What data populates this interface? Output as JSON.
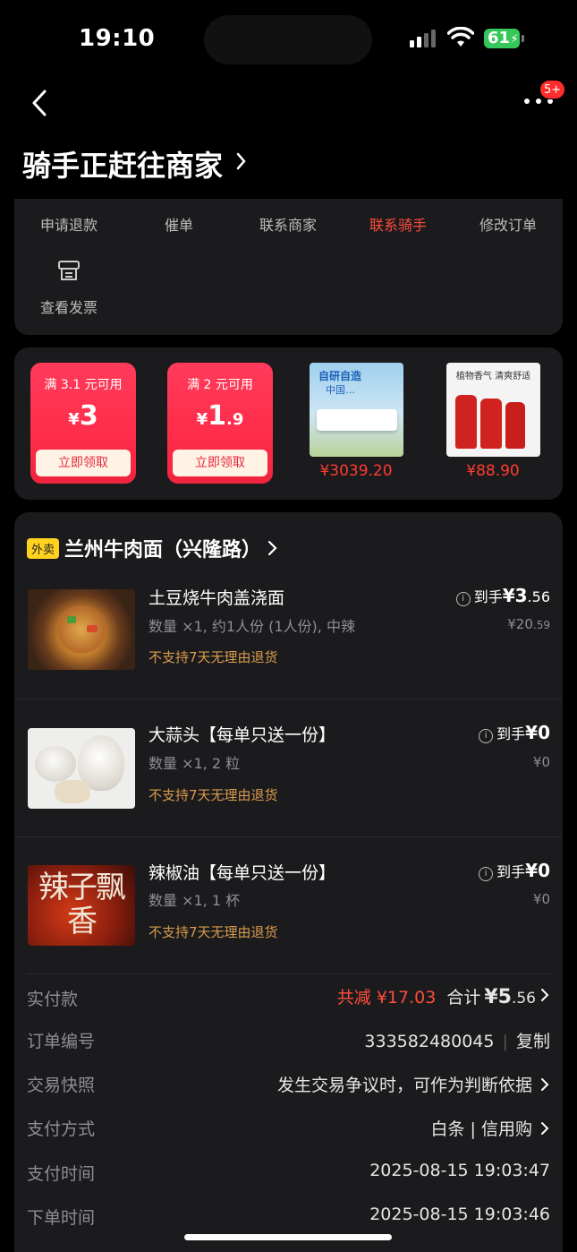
{
  "status_bar": {
    "time": "19:10",
    "battery": "61"
  },
  "nav": {
    "badge": "5+"
  },
  "header": {
    "title": "骑手正赶往商家"
  },
  "actions": {
    "refund": "申请退款",
    "urge": "催单",
    "contact_store": "联系商家",
    "contact_rider": "联系骑手",
    "modify": "修改订单",
    "invoice": "查看发票"
  },
  "promos": {
    "coupons": [
      {
        "condition": "满 3.1 元可用",
        "currency": "¥",
        "amount_int": "3",
        "amount_dec": "",
        "button": "立即领取"
      },
      {
        "condition": "满 2 元可用",
        "currency": "¥",
        "amount_int": "1",
        "amount_dec": ".9",
        "button": "立即领取"
      }
    ],
    "products": [
      {
        "price": "¥3039.20",
        "image_text_1": "自研自造",
        "image_text_2": "中国…"
      },
      {
        "price": "¥88.90",
        "image_text_1": "植物香气 清爽舒适"
      }
    ]
  },
  "order": {
    "tag": "外卖",
    "store": "兰州牛肉面（兴隆路）",
    "items": [
      {
        "name": "土豆烧牛肉盖浇面",
        "spec": "数量 ×1, 约1人份 (1人份), 中辣",
        "note": "不支持7天无理由退货",
        "final_label": "到手",
        "final_int": "¥3",
        "final_dec": ".56",
        "orig_int": "¥20",
        "orig_dec": ".59"
      },
      {
        "name": "大蒜头【每单只送一份】",
        "spec": "数量 ×1, 2 粒",
        "note": "不支持7天无理由退货",
        "final_label": "到手",
        "final_int": "¥0",
        "final_dec": "",
        "orig_int": "¥0",
        "orig_dec": ""
      },
      {
        "name": "辣椒油【每单只送一份】",
        "spec": "数量 ×1, 1 杯",
        "note": "不支持7天无理由退货",
        "final_label": "到手",
        "final_int": "¥0",
        "final_dec": "",
        "orig_int": "¥0",
        "orig_dec": "",
        "image_text": "辣子飘香"
      }
    ],
    "summary": {
      "paid_label": "实付款",
      "discount": "共减 ¥17.03",
      "total_label": "合计",
      "total_int": "¥5",
      "total_dec": ".56",
      "order_no_label": "订单编号",
      "order_no": "333582480045",
      "copy": "复制",
      "snapshot_label": "交易快照",
      "snapshot_value": "发生交易争议时，可作为判断依据",
      "pay_method_label": "支付方式",
      "pay_method": "白条 | 信用购",
      "pay_time_label": "支付时间",
      "pay_time": "2025-08-15 19:03:47",
      "order_time_label": "下单时间",
      "order_time": "2025-08-15 19:03:46"
    }
  },
  "colors": {
    "accent_red": "#ff4c3b",
    "note_orange": "#d99a4c",
    "tag_yellow": "#ffd21f",
    "coupon_red": "#ff2d4a"
  }
}
